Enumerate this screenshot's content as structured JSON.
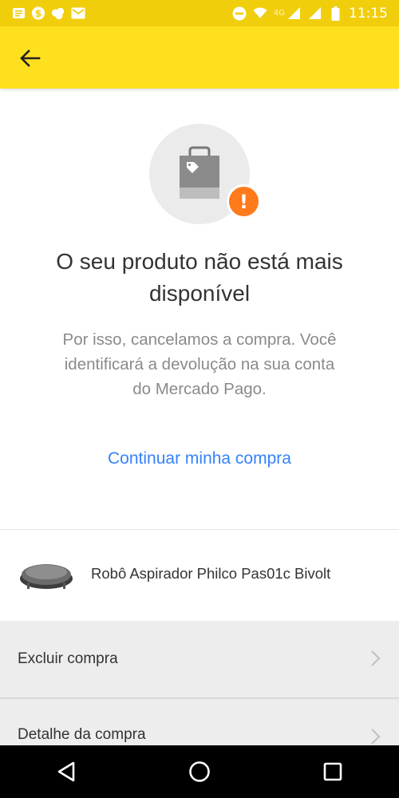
{
  "status_bar": {
    "time": "11:15",
    "network": "4G",
    "icons": [
      "notes-icon",
      "dollar-icon",
      "cloud-icon",
      "mail-icon",
      "dnd-icon",
      "wifi-icon",
      "signal-icon",
      "battery-icon"
    ]
  },
  "colors": {
    "status_bar": "#f1ce0c",
    "app_bar": "#ffe01e",
    "warning": "#ff7a1a",
    "link": "#3483fa",
    "row_bg": "#ededed"
  },
  "header": {
    "back_icon": "arrow-left-icon"
  },
  "hero": {
    "icon": "shopping-bag-icon",
    "badge": "!",
    "title_line1": "O seu produto não está mais",
    "title_line2": "disponível",
    "desc_line1": "Por isso, cancelamos a compra. Você",
    "desc_line2": "identificará a devolução na sua conta",
    "desc_line3": "do Mercado Pago.",
    "continue_label": "Continuar minha compra"
  },
  "product": {
    "name": "Robô Aspirador Philco Pas01c Bivolt"
  },
  "actions": [
    {
      "label": "Excluir compra"
    },
    {
      "label": "Detalhe da compra"
    }
  ]
}
